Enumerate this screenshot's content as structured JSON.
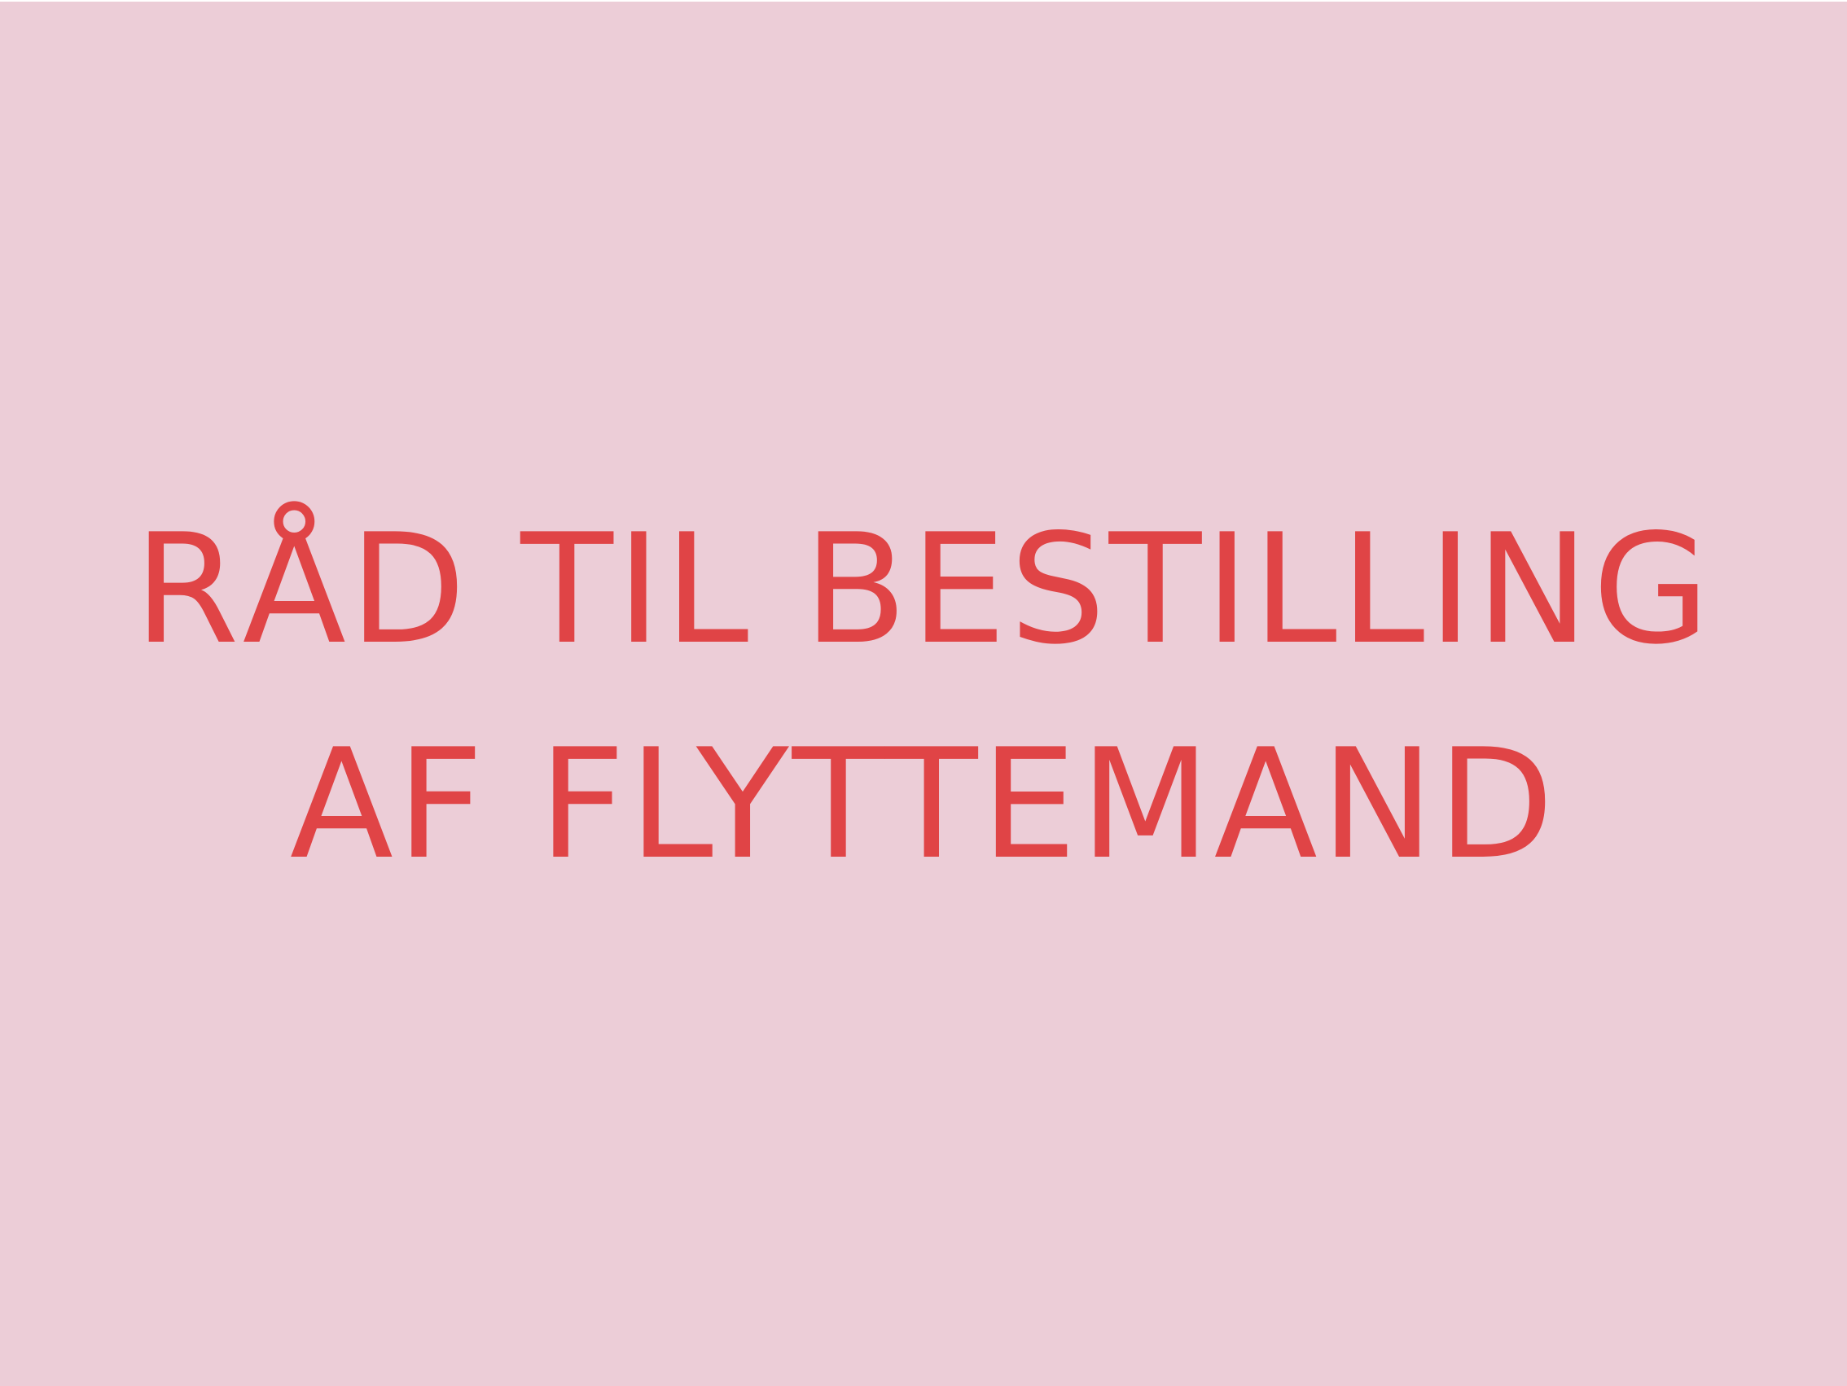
{
  "background_color": "#eccdd7",
  "text_color": "#e04446",
  "heading": {
    "line1": "RÅD TIL BESTILLING",
    "line2": "AF FLYTTEMAND"
  }
}
